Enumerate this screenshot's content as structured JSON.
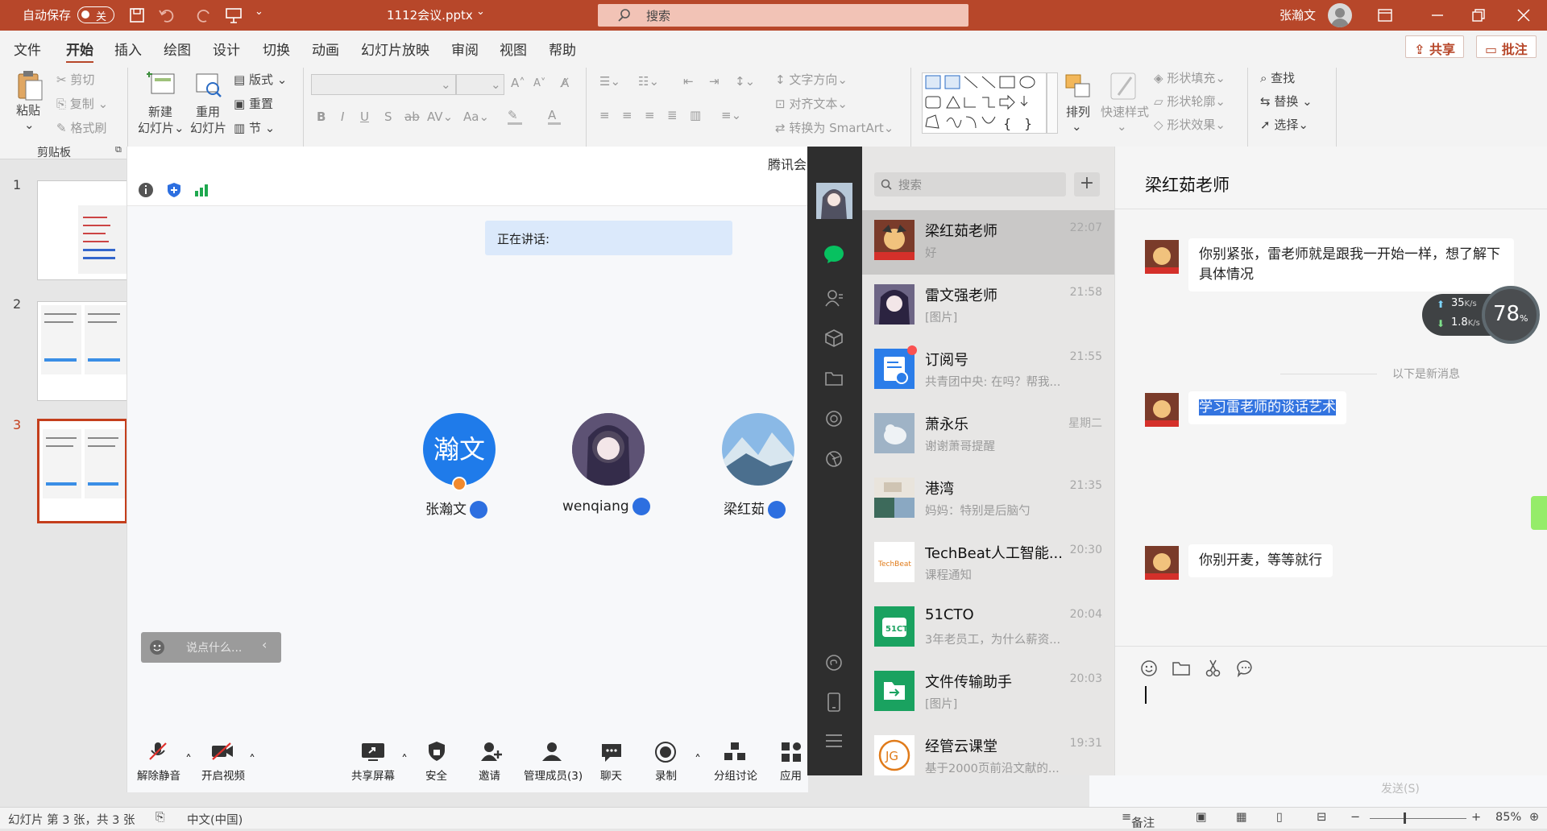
{
  "titlebar": {
    "autosave_label": "自动保存",
    "autosave_state": "关",
    "filename": "1112会议.pptx",
    "search_placeholder": "搜索",
    "user_name": "张瀚文"
  },
  "ribbon_tabs": [
    "文件",
    "开始",
    "插入",
    "绘图",
    "设计",
    "切换",
    "动画",
    "幻灯片放映",
    "审阅",
    "视图",
    "帮助"
  ],
  "ribbon_actions": {
    "share": "共享",
    "comment": "批注"
  },
  "clipboard": {
    "paste": "粘贴",
    "cut": "剪切",
    "copy": "复制",
    "format_painter": "格式刷",
    "group": "剪贴板"
  },
  "slides_group": {
    "new_slide_1": "新建",
    "new_slide_2": "幻灯片",
    "reuse_1": "重用",
    "reuse_2": "幻灯片",
    "layout": "版式",
    "reset": "重置",
    "section": "节"
  },
  "font_group": {
    "bold": "B",
    "italic": "I",
    "underline": "U",
    "shadow": "S",
    "strike": "ab",
    "spacing": "AV",
    "case": "Aa"
  },
  "paragraph_group": {
    "text_direction": "文字方向",
    "align_text": "对齐文本",
    "smartart": "转换为 SmartArt"
  },
  "drawing_group": {
    "arrange": "排列",
    "quick_styles": "快速样式",
    "fill": "形状填充",
    "outline": "形状轮廓",
    "effects": "形状效果"
  },
  "editing_group": {
    "find": "查找",
    "replace": "替换",
    "select": "选择"
  },
  "slide_numbers": [
    "1",
    "2",
    "3"
  ],
  "meeting": {
    "window_title": "腾讯会",
    "speaking_label": "正在讲话:",
    "participants": [
      {
        "name": "张瀚文",
        "avatar_text": "瀚文"
      },
      {
        "name": "wenqiang"
      },
      {
        "name": "梁红茹"
      }
    ],
    "chat_placeholder": "说点什么...",
    "toolbar": [
      "解除静音",
      "开启视频",
      "共享屏幕",
      "安全",
      "邀请",
      "管理成员(3)",
      "聊天",
      "录制",
      "分组讨论",
      "应用"
    ]
  },
  "wechat": {
    "search_placeholder": "搜索",
    "contacts": [
      {
        "name": "梁红茹老师",
        "preview": "好",
        "time": "22:07"
      },
      {
        "name": "雷文强老师",
        "preview": "[图片]",
        "time": "21:58"
      },
      {
        "name": "订阅号",
        "preview": "共青团中央: 在吗？帮我...",
        "time": "21:55"
      },
      {
        "name": "萧永乐",
        "preview": "谢谢萧哥提醒",
        "time": "星期二"
      },
      {
        "name": "港湾",
        "preview": "妈妈：特别是后脑勺",
        "time": "21:35"
      },
      {
        "name": "TechBeat人工智能...",
        "preview": "课程通知",
        "time": "20:30"
      },
      {
        "name": "51CTO",
        "preview": "3年老员工，为什么薪资...",
        "time": "20:04"
      },
      {
        "name": "文件传输助手",
        "preview": "[图片]",
        "time": "20:03"
      },
      {
        "name": "经管云课堂",
        "preview": "基于2000页前沿文献的...",
        "time": "19:31"
      }
    ],
    "chat_title": "梁红茹老师",
    "messages": [
      {
        "text": "你别紧张，雷老师就是跟我一开始一样，想了解下具体情况"
      },
      {
        "text": "学习雷老师的谈话艺术"
      },
      {
        "text": "你别开麦，等等就行"
      }
    ],
    "new_messages_divider": "以下是新消息",
    "net_up": "35",
    "net_down": "1.8",
    "net_unit": "K/s",
    "cpu_percent": "78",
    "cpu_unit": "%",
    "send_hint": "发送(S)"
  },
  "statusbar": {
    "slide_info": "幻灯片 第 3 张，共 3 张",
    "language": "中文(中国)",
    "notes": "备注",
    "zoom": "85%"
  },
  "colors": {
    "ppt_accent": "#b7472a",
    "wechat_green": "#07c160",
    "meeting_blue": "#2d6fe0",
    "selection_blue": "#3374e0"
  }
}
